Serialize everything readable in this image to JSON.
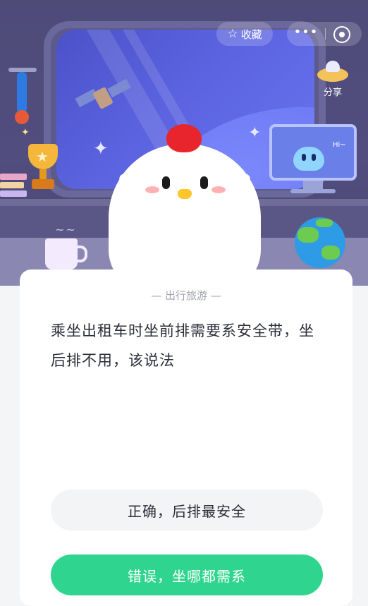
{
  "header": {
    "favorite_label": "收藏",
    "more_label": "•••",
    "share_label": "分享"
  },
  "scene": {
    "monitor_text": "Hi~",
    "steam": "~~"
  },
  "quiz": {
    "category": "— 出行旅游 —",
    "question": "乘坐出租车时坐前排需要系安全带，坐后排不用，该说法",
    "answers": [
      {
        "label": "正确，后排最安全"
      },
      {
        "label": "错误，坐哪都需系"
      }
    ]
  },
  "colors": {
    "primary_answer": "#2fd58e",
    "secondary_answer": "#f3f4f6",
    "scene_bg": "#4e4b79"
  }
}
